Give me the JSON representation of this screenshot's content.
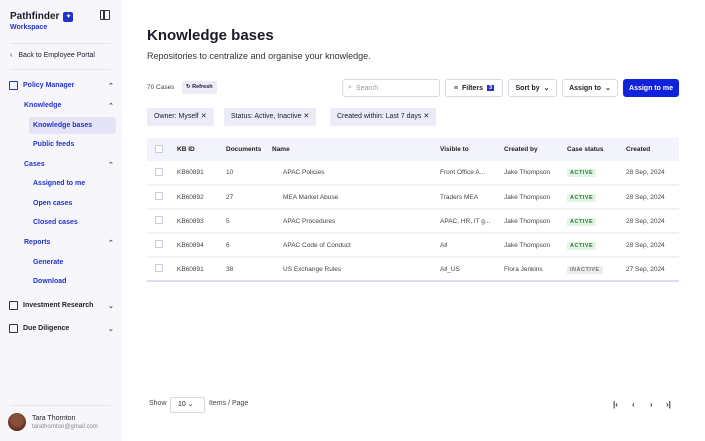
{
  "sidebar": {
    "brand": "Pathfinder",
    "workspace": "Workspace",
    "back": "Back to Employee Portal",
    "sections": [
      {
        "label": "Policy Manager",
        "icon": "policy-manager-icon",
        "groups": [
          {
            "label": "Knowledge",
            "items": [
              "Knowledge bases",
              "Public feeds"
            ]
          },
          {
            "label": "Cases",
            "items": [
              "Assigned to me",
              "Open cases",
              "Closed cases"
            ]
          },
          {
            "label": "Reports",
            "items": [
              "Generate",
              "Download"
            ]
          }
        ]
      },
      {
        "label": "Investment Research",
        "icon": "investment-research-icon"
      },
      {
        "label": "Due Diligence",
        "icon": "due-diligence-icon"
      }
    ],
    "selected": "Knowledge bases",
    "user": {
      "name": "Tara Thornton",
      "email": "tarathornton@gmail.com"
    }
  },
  "header": {
    "title": "Knowledge bases",
    "subtitle": "Repositories to centralize and organise your knowledge."
  },
  "toolbar": {
    "count": "70 Cases",
    "refresh": "Refresh",
    "search_placeholder": "Search",
    "filters": "Filters",
    "filters_count": "3",
    "sort_by": "Sort by",
    "assign_to": "Assign to",
    "assign_to_me": "Assign to me"
  },
  "chips": [
    "Owner: Myself",
    "Status: Active, Inactive",
    "Created within: Last 7 days"
  ],
  "table": {
    "columns": [
      "KB ID",
      "Documents",
      "Name",
      "Visible to",
      "Created by",
      "Case status",
      "Created"
    ],
    "rows": [
      [
        "KB60891",
        "10",
        "APAC Policies",
        "Front Office A...",
        "Jake Thompson",
        "ACTIVE",
        "28 Sep, 2024"
      ],
      [
        "KB60892",
        "27",
        "MEA Market Abuse",
        "Traders MEA",
        "Jake Thompson",
        "ACTIVE",
        "28 Sep, 2024"
      ],
      [
        "KB60893",
        "5",
        "APAC Procedures",
        "APAC, HR, IT g...",
        "Jake Thompson",
        "ACTIVE",
        "28 Sep, 2024"
      ],
      [
        "KB60894",
        "6",
        "APAC Code of Conduct",
        "All",
        "Jake Thompson",
        "ACTIVE",
        "28 Sep, 2024"
      ],
      [
        "KB60891",
        "38",
        "US Exchange Rules",
        "All_US",
        "Flora Jenkins",
        "INACTIVE",
        "27 Sep, 2024"
      ]
    ]
  },
  "pagination": {
    "show": "Show",
    "page_size": "10",
    "items_per_page": "Items / Page"
  },
  "colors": {
    "accent": "#1122dd",
    "active_bg": "#e1f5e5",
    "inactive_bg": "#ececec"
  }
}
